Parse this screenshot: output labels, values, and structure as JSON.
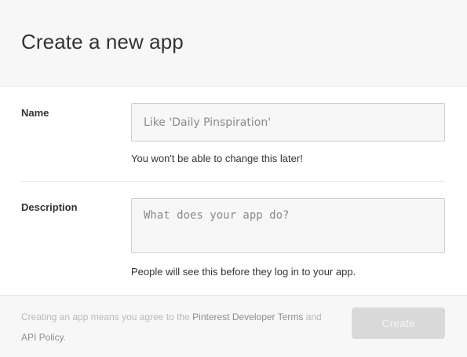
{
  "header": {
    "title": "Create a new app"
  },
  "form": {
    "name": {
      "label": "Name",
      "placeholder": "Like 'Daily Pinspiration'",
      "value": "",
      "help": "You won't be able to change this later!"
    },
    "description": {
      "label": "Description",
      "placeholder": "What does your app do?",
      "value": "",
      "help": "People will see this before they log in to your app."
    }
  },
  "footer": {
    "terms_prefix": "Creating an app means you agree to the ",
    "terms_link": "Pinterest Developer Terms",
    "terms_middle": " and ",
    "policy_link": "API Policy",
    "terms_suffix": ".",
    "create_label": "Create"
  }
}
